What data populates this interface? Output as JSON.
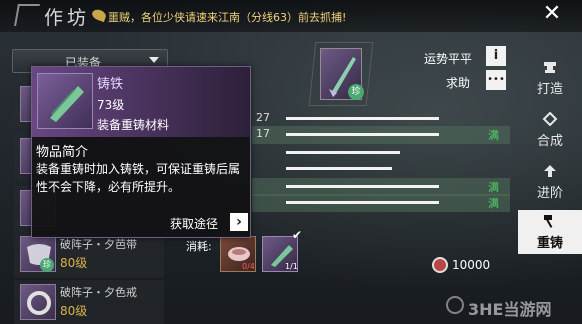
{
  "header": {
    "title": "作坊",
    "notice": "噩贼，各位少侠请速来江南（分线63）前去抓捕!"
  },
  "left": {
    "dropdown_label": "已装备",
    "items": [
      {
        "name": "破阵子・夕芭带",
        "level": "80级",
        "badge": "珍"
      },
      {
        "name": "破阵子・夕色戒",
        "level": "80级",
        "badge": ""
      }
    ]
  },
  "tooltip": {
    "name": "铸铁",
    "level": "73级",
    "type": "装备重铸材料",
    "section_title": "物品简介",
    "description": "装备重铸时加入铸铁，可保证重铸后属性不会下降，必有所提升。",
    "link_label": "获取途径"
  },
  "main": {
    "item_badge": "珍",
    "luck_label": "运势平平",
    "help_label": "求助",
    "stats": [
      {
        "num": "27",
        "full": "",
        "fill": 0.78
      },
      {
        "num": "17",
        "full": "满",
        "fill": 0.78
      },
      {
        "num": "",
        "full": "",
        "fill": 0.58
      },
      {
        "num": "",
        "full": "",
        "fill": 0.54
      },
      {
        "num": "",
        "full": "满",
        "fill": 0.78
      },
      {
        "num": "",
        "full": "满",
        "fill": 0.78
      }
    ],
    "consume_label": "消耗:",
    "consume_1_count": "0/4",
    "consume_2_count": "1/1",
    "coins": "10000"
  },
  "tabs": [
    {
      "label": "打造"
    },
    {
      "label": "合成"
    },
    {
      "label": "进阶"
    },
    {
      "label": "重铸"
    }
  ],
  "watermark": "3HE当游网"
}
